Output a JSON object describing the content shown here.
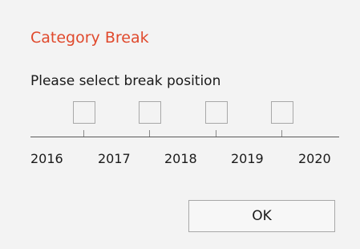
{
  "dialog": {
    "title": "Category Break",
    "prompt": "Please select break position",
    "ok_label": "OK"
  },
  "slots": [
    {
      "between": "2016-2017",
      "checked": false
    },
    {
      "between": "2017-2018",
      "checked": false
    },
    {
      "between": "2018-2019",
      "checked": false
    },
    {
      "between": "2019-2020",
      "checked": false
    }
  ],
  "axis": {
    "years": [
      "2016",
      "2017",
      "2018",
      "2019",
      "2020"
    ]
  },
  "colors": {
    "title": "#e0492c",
    "background": "#f3f3f3",
    "border": "#a8a8a8"
  }
}
